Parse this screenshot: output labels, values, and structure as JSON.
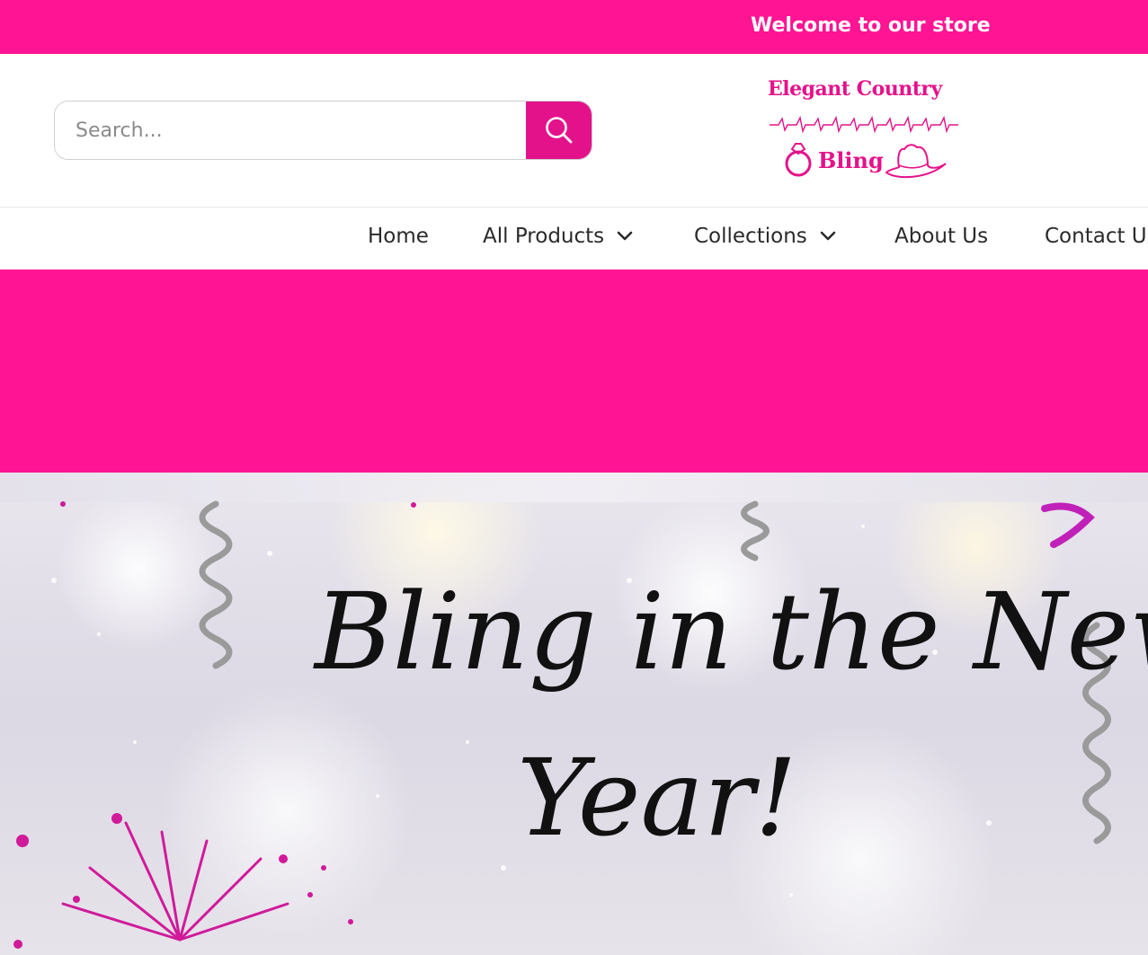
{
  "announcement": {
    "text": "Welcome to our store"
  },
  "search": {
    "placeholder": "Search..."
  },
  "logo": {
    "line1": "Elegant Country",
    "line2": "Bling"
  },
  "nav": {
    "items": [
      {
        "label": "Home",
        "has_dropdown": false
      },
      {
        "label": "All Products",
        "has_dropdown": true
      },
      {
        "label": "Collections",
        "has_dropdown": true
      },
      {
        "label": "About Us",
        "has_dropdown": false
      },
      {
        "label": "Contact Us",
        "has_dropdown": false
      }
    ]
  },
  "hero": {
    "line1": "Bling in the New",
    "line2": "Year!"
  },
  "colors": {
    "brand_pink": "#ff1493",
    "accent_pink": "#e4128a",
    "text_dark": "#2a2a2a"
  }
}
